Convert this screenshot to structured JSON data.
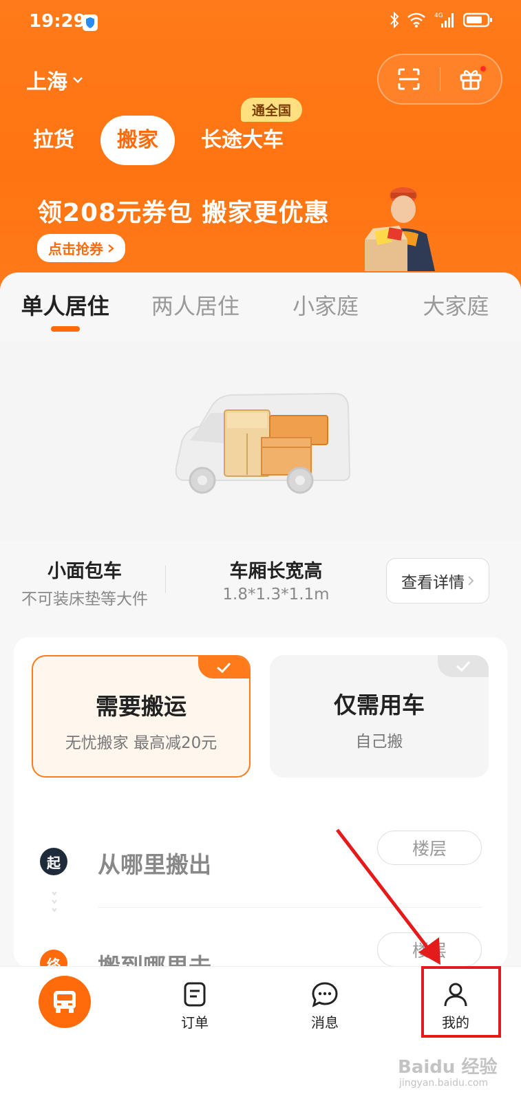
{
  "status_bar": {
    "time": "19:29",
    "network": "4G"
  },
  "header": {
    "city": "上海",
    "service_tabs": [
      "拉货",
      "搬家",
      "长途大车"
    ],
    "active_service_tab": "搬家",
    "badge": "通全国"
  },
  "promo": {
    "title": "领208元券包 搬家更优惠",
    "button": "点击抢券"
  },
  "size_tabs": [
    "单人居住",
    "两人居住",
    "小家庭",
    "大家庭"
  ],
  "vehicle": {
    "name": "小面包车",
    "note": "不可装床垫等大件",
    "dimension_label": "车厢长宽高",
    "dimension_value": "1.8*1.3*1.1m",
    "detail_button": "查看详情"
  },
  "options": [
    {
      "title": "需要搬运",
      "subtitle": "无忧搬家 最高减20元",
      "selected": true
    },
    {
      "title": "仅需用车",
      "subtitle": "自己搬",
      "selected": false
    }
  ],
  "address": {
    "start_badge": "起",
    "start_placeholder": "从哪里搬出",
    "end_badge": "终",
    "end_placeholder": "搬到哪里去",
    "floor_label": "楼层"
  },
  "bottom_nav": {
    "orders": "订单",
    "messages": "消息",
    "mine": "我的"
  },
  "colors": {
    "accent": "#ff6a0b",
    "highlight": "#e51b1b"
  },
  "watermark": {
    "text": "Baidu 经验",
    "sub": "jingyan.baidu.com"
  }
}
